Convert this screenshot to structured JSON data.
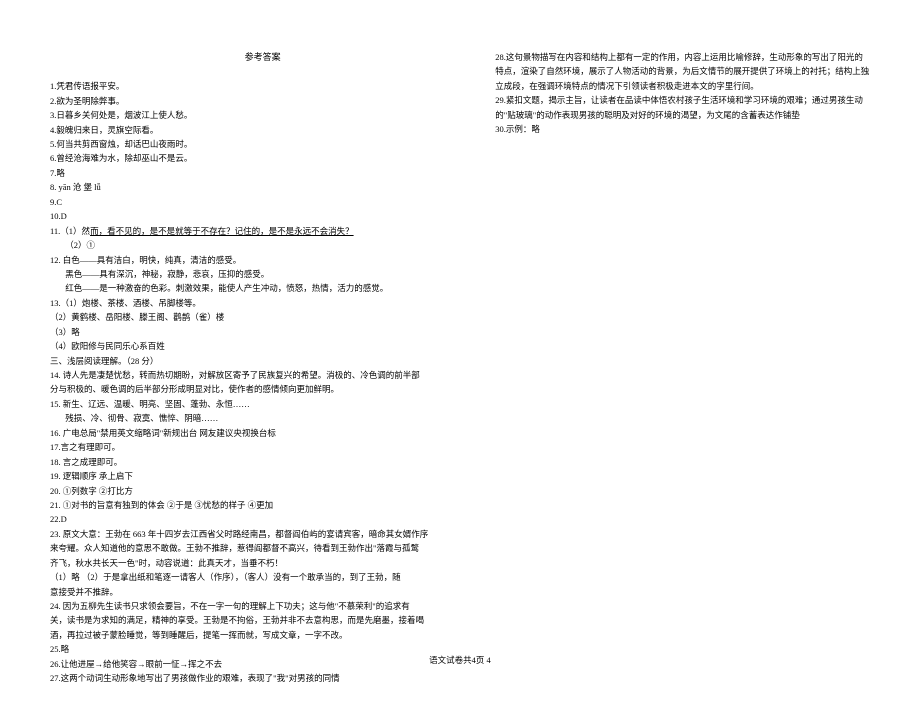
{
  "title": "参考答案",
  "left_column": [
    {
      "text": "1.凭君传语报平安。"
    },
    {
      "text": "2.欲为圣明除弊事。"
    },
    {
      "text": "3.日暮乡关何处是，烟波江上使人愁。"
    },
    {
      "text": "4.毅魄归来日，灵旗空际看。"
    },
    {
      "text": "5.何当共剪西窗烛，却话巴山夜雨时。"
    },
    {
      "text": "6.曾经沧海难为水，除却巫山不是云。"
    },
    {
      "text": "7.略"
    },
    {
      "text": "8.  yān     沧    堡    lǚ"
    },
    {
      "text": "9.C"
    },
    {
      "text": "10.D"
    },
    {
      "text": "11.（1）然而，看不见的，是不是就等于不存在？记住的，是不是永远不会消失？",
      "underline_range": [
        7,
        100
      ]
    },
    {
      "text": "（2）①",
      "indent": true
    },
    {
      "text": "12.  白色——具有洁白，明快，纯真，清洁的感受。"
    },
    {
      "text": "黑色——具有深沉，神秘，寂静，悲哀，压抑的感受。",
      "indent": true
    },
    {
      "text": "红色——是一种激奋的色彩。刺激效果，能使人产生冲动，愤怒，热情，活力的感觉。",
      "indent": true
    },
    {
      "text": "13.（1）炮楼、茶楼、酒楼、吊脚楼等。"
    },
    {
      "text": "（2）黄鹤楼、岳阳楼、滕王阁、鹳鹊（雀）楼"
    },
    {
      "text": "（3）略"
    },
    {
      "text": "（4）欧阳修与民同乐心系百姓"
    },
    {
      "text": "三、浅层阅读理解。（28 分）"
    },
    {
      "text": "14.  诗人先是凄楚忧愁，转而热切期盼，对解放区寄予了民族复兴的希望。消极的、冷色调的前半部"
    },
    {
      "text": "分与积极的、暖色调的后半部分形成明显对比，使作者的感情倾向更加鲜明。"
    },
    {
      "text": "15.  新生、辽远、温暖、明亮、坚固、蓬勃、永恒……"
    },
    {
      "text": "残损、冷、彻骨、寂寞、憔悴、阴暗……",
      "indent": true
    },
    {
      "text": "16.  广电总局\"禁用英文缩略词\"新规出台  网友建议央视换台标"
    },
    {
      "text": "17.言之有理即可。"
    },
    {
      "text": "18.  言之成理即可。"
    },
    {
      "text": "19.  逻辑顺序        承上启下"
    },
    {
      "text": "20.  ①列数字    ②打比方"
    },
    {
      "text": "21.  ①对书的旨意有独到的体会        ②于是        ③忧愁的样子        ④更加"
    },
    {
      "text": "22.D"
    },
    {
      "text": "23.  原文大意：王勃在 663 年十四岁去江西省父时路经南昌，都督阎伯屿的宴请宾客，暗命其女婿作序"
    },
    {
      "text": "来夸耀。众人知道他的意思不敢做。王勃不推辞，惹得阎都督不高兴，待看到王勃作出\"落霞与孤鹜"
    },
    {
      "text": "齐飞，秋水共长天一色\"时，动容说道：此真天才，当垂不朽！"
    },
    {
      "text": "（1）略        （2）于是拿出纸和笔逐一请客人（作序），（客人）没有一个敢承当的，到了王勃，随"
    },
    {
      "text": "意接受并不推辞。"
    },
    {
      "text": "24.  因为五柳先生读书只求领会要旨，不在一字一句的理解上下功夫；这与他\"不慕荣利\"的追求有"
    },
    {
      "text": "关，读书是为求知的满足，精神的享受。王勃是不拘俗，王勃并非不去意构思，而是先磨墨，接着喝"
    },
    {
      "text": "酒，再拉过被子蒙脸睡觉，等到睡醒后，提笔一挥而就，写成文章，一字不改。"
    },
    {
      "text": "25.略"
    },
    {
      "text": "26.让他进屋→给他笑容→眼前一怔→挥之不去"
    },
    {
      "text": "27.这两个动词生动形象地写出了男孩做作业的艰难，表现了\"我\"对男孩的同情"
    }
  ],
  "right_column": [
    {
      "text": "28.这句景物描写在内容和结构上都有一定的作用，内容上运用比喻修辞，生动形象的写出了阳光的"
    },
    {
      "text": "特点，渲染了自然环境，展示了人物活动的背景，为后文情节的展开提供了环境上的衬托；结构上独"
    },
    {
      "text": "立成段，在强调环境特点的情况下引领读者积极走进本文的字里行间。"
    },
    {
      "text": "29.紧扣文题，揭示主旨，让读者在品读中体悟农村孩子生活环境和学习环境的艰难；通过男孩生动"
    },
    {
      "text": "的\"贴玻璃\"的动作表现男孩的聪明及对好的环境的渴望，为文尾的含蓄表达作铺垫"
    },
    {
      "text": "30.示例：略"
    }
  ],
  "footer": "语文试卷共4页    4"
}
